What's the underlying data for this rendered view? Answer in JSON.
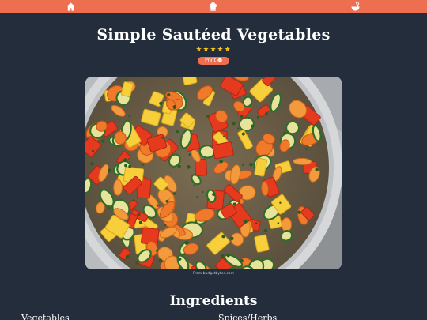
{
  "nav": {
    "items": [
      {
        "name": "home",
        "icon": "house-icon"
      },
      {
        "name": "recipes",
        "icon": "chef-hat-icon"
      },
      {
        "name": "cooking",
        "icon": "bowl-whisk-icon"
      }
    ]
  },
  "recipe": {
    "title": "Simple Sautéed Vegetables",
    "rating": 5,
    "rating_max": 5,
    "stars": "★★★★★",
    "print_label": "Print",
    "print_icon": "printer-icon",
    "image_credit": "From budgetbytes.com",
    "ingredients_heading": "Ingredients",
    "ingredient_groups": [
      "Vegetables",
      "Spices/Herbs"
    ]
  },
  "colors": {
    "accent": "#ee6e50",
    "background": "#242d3b",
    "star": "#f4c21a",
    "text": "#ffffff"
  }
}
